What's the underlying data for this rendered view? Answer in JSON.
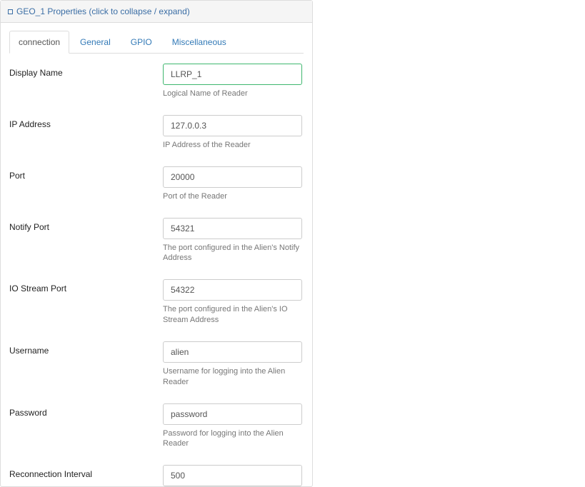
{
  "panel": {
    "header": "GEO_1 Properties (click to collapse / expand)"
  },
  "tabs": [
    {
      "id": "connection",
      "label": "connection",
      "active": true
    },
    {
      "id": "general",
      "label": "General",
      "active": false
    },
    {
      "id": "gpio",
      "label": "GPIO",
      "active": false
    },
    {
      "id": "misc",
      "label": "Miscellaneous",
      "active": false
    }
  ],
  "fields": {
    "displayName": {
      "label": "Display Name",
      "value": "LLRP_1",
      "help": "Logical Name of Reader"
    },
    "ipAddress": {
      "label": "IP Address",
      "value": "127.0.0.3",
      "help": "IP Address of the Reader"
    },
    "port": {
      "label": "Port",
      "value": "20000",
      "help": "Port of the Reader"
    },
    "notifyPort": {
      "label": "Notify Port",
      "value": "54321",
      "help": "The port configured in the Alien's Notify Address"
    },
    "ioStreamPort": {
      "label": "IO Stream Port",
      "value": "54322",
      "help": "The port configured in the Alien's IO Stream Address"
    },
    "username": {
      "label": "Username",
      "value": "alien",
      "help": "Username for logging into the Alien Reader"
    },
    "password": {
      "label": "Password",
      "value": "password",
      "help": "Password for logging into the Alien Reader"
    },
    "reconnectionInterval": {
      "label": "Reconnection Interval",
      "value": "500",
      "help": ""
    }
  }
}
